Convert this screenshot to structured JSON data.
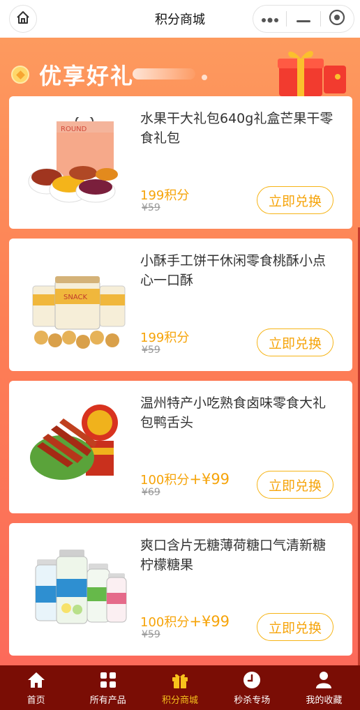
{
  "nav": {
    "title": "积分商城"
  },
  "banner": {
    "title": "优享好礼"
  },
  "action_label": "立即兑换",
  "products": [
    {
      "name": "水果干大礼包640g礼盒芒果干零食礼包",
      "points": "199积分",
      "cash": "",
      "original": "¥59",
      "image": "dried-fruit-gift-box"
    },
    {
      "name": "小酥手工饼干休闲零食桃酥小点心一口酥",
      "points": "199积分",
      "cash": "",
      "original": "¥59",
      "image": "walnut-cookie-jars"
    },
    {
      "name": "温州特产小吃熟食卤味零食大礼包鸭舌头",
      "points": "100积分",
      "cash": "+¥99",
      "original": "¥69",
      "image": "braised-duck-tongue"
    },
    {
      "name": "爽口含片无糖薄荷糖口气清新糖柠檬糖果",
      "points": "100积分",
      "cash": "+¥99",
      "original": "¥59",
      "image": "mint-candy-bottles"
    }
  ],
  "tabs": [
    {
      "label": "首页",
      "icon": "home-icon"
    },
    {
      "label": "所有产品",
      "icon": "grid-icon"
    },
    {
      "label": "积分商城",
      "icon": "gift-icon",
      "active": true
    },
    {
      "label": "秒杀专场",
      "icon": "clock-icon"
    },
    {
      "label": "我的收藏",
      "icon": "user-icon"
    }
  ],
  "colors": {
    "accent": "#f6a40a",
    "tabbar": "#7a0d05",
    "tab_active": "#f7c21c"
  }
}
